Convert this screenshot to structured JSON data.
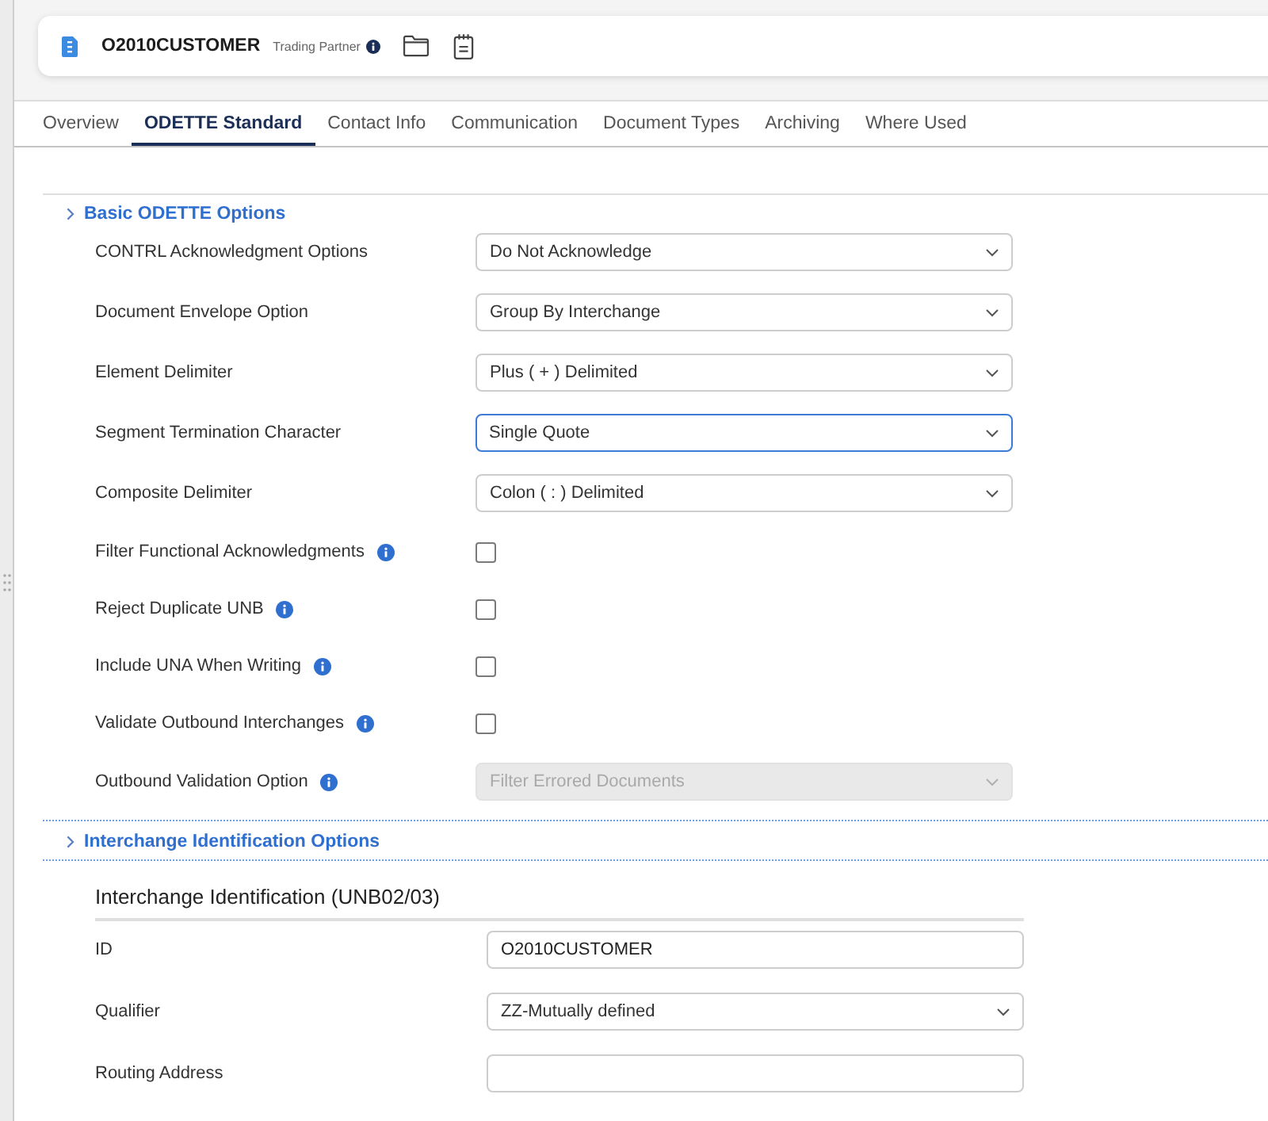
{
  "header": {
    "title": "O2010CUSTOMER",
    "subtitle": "Trading Partner",
    "info": true
  },
  "tabs": [
    {
      "label": "Overview",
      "selected": false
    },
    {
      "label": "ODETTE Standard",
      "selected": true
    },
    {
      "label": "Contact Info",
      "selected": false
    },
    {
      "label": "Communication",
      "selected": false
    },
    {
      "label": "Document Types",
      "selected": false
    },
    {
      "label": "Archiving",
      "selected": false
    },
    {
      "label": "Where Used",
      "selected": false
    }
  ],
  "sections": [
    {
      "title": "Basic ODETTE Options",
      "fields": [
        {
          "kind": "select",
          "label": "CONTRL Acknowledgment Options",
          "info": false,
          "value": "Do Not Acknowledge",
          "focused": false,
          "disabled": false
        },
        {
          "kind": "select",
          "label": "Document Envelope Option",
          "info": false,
          "value": "Group By Interchange",
          "focused": false,
          "disabled": false
        },
        {
          "kind": "select",
          "label": "Element Delimiter",
          "info": false,
          "value": "Plus ( + ) Delimited",
          "focused": false,
          "disabled": false
        },
        {
          "kind": "select",
          "label": "Segment Termination Character",
          "info": false,
          "value": "Single Quote",
          "focused": true,
          "disabled": false
        },
        {
          "kind": "select",
          "label": "Composite Delimiter",
          "info": false,
          "value": "Colon ( : ) Delimited",
          "focused": false,
          "disabled": false
        },
        {
          "kind": "checkbox",
          "label": "Filter Functional Acknowledgments",
          "info": true,
          "checked": false
        },
        {
          "kind": "checkbox",
          "label": "Reject Duplicate UNB",
          "info": true,
          "checked": false
        },
        {
          "kind": "checkbox",
          "label": "Include UNA When Writing",
          "info": true,
          "checked": false
        },
        {
          "kind": "checkbox",
          "label": "Validate Outbound Interchanges",
          "info": true,
          "checked": false
        },
        {
          "kind": "select",
          "label": "Outbound Validation Option",
          "info": true,
          "value": "Filter Errored Documents",
          "focused": false,
          "disabled": true
        }
      ]
    },
    {
      "title": "Interchange Identification Options",
      "groups": [
        {
          "title": "Interchange Identification (UNB02/03)",
          "fields": [
            {
              "kind": "text",
              "label": "ID",
              "info": false,
              "value": "O2010CUSTOMER",
              "focused": false,
              "disabled": false
            },
            {
              "kind": "select",
              "label": "Qualifier",
              "info": false,
              "value": "ZZ-Mutually defined",
              "focused": false,
              "disabled": false
            },
            {
              "kind": "text",
              "label": "Routing Address",
              "info": false,
              "focused": false,
              "disabled": false
            }
          ]
        }
      ]
    }
  ]
}
